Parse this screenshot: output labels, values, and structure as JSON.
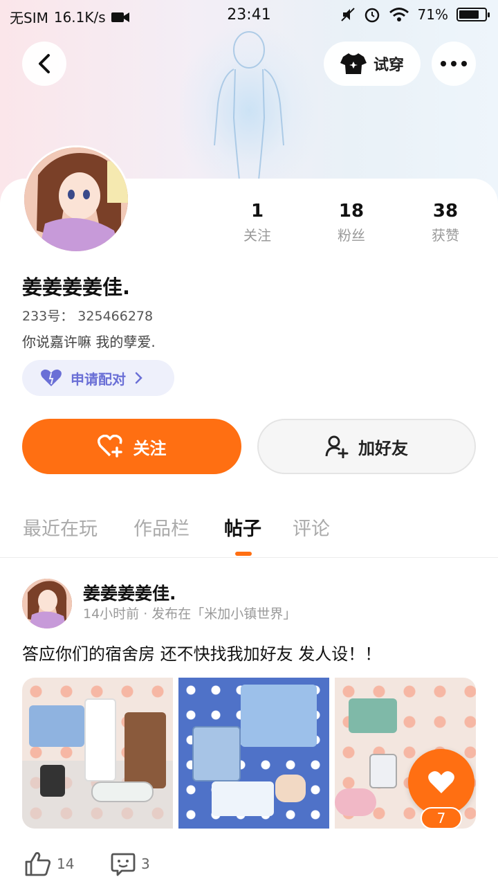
{
  "status_bar": {
    "carrier": "无SIM",
    "speed": "16.1K/s",
    "time": "23:41",
    "battery": "71%"
  },
  "header": {
    "try_on_label": "试穿",
    "icons": [
      "back-icon",
      "shirt-icon",
      "more-icon"
    ]
  },
  "profile": {
    "name": "姜姜姜姜佳.",
    "id_line": "233号： 325466278",
    "bio": "你说嘉许嘛 我的孽爱.",
    "pair_label": "申请配对",
    "stats": [
      {
        "num": "1",
        "label": "关注"
      },
      {
        "num": "18",
        "label": "粉丝"
      },
      {
        "num": "38",
        "label": "获赞"
      }
    ],
    "follow_label": "关注",
    "add_friend_label": "加好友"
  },
  "tabs": [
    {
      "label": "最近在玩",
      "active": false
    },
    {
      "label": "作品栏",
      "active": false
    },
    {
      "label": "帖子",
      "active": true
    },
    {
      "label": "评论",
      "active": false
    }
  ],
  "post": {
    "author": "姜姜姜姜佳.",
    "meta": "14小时前 · 发布在「米加小镇世界」",
    "text": "答应你们的宿舍房 还不快找我加好友 发人设！！",
    "likes": "14",
    "comments": "3",
    "fab_count": "7"
  },
  "colors": {
    "accent": "#ff6f12",
    "pair_text": "#6a6fd6"
  }
}
